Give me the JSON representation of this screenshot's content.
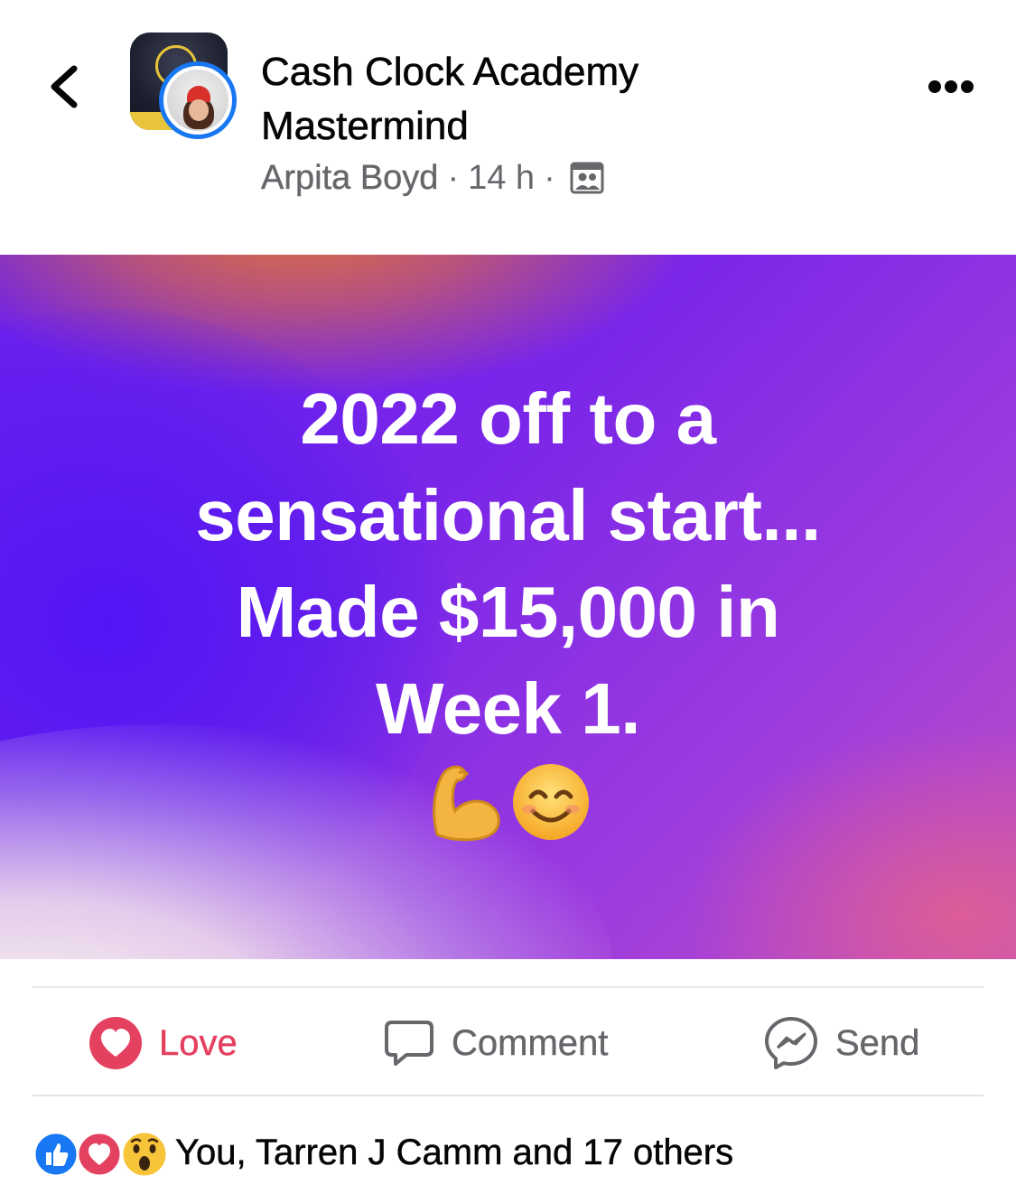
{
  "header": {
    "group_title_line1": "Cash Clock Academy",
    "group_title_line2": "Mastermind",
    "author": "Arpita Boyd",
    "separator": "·",
    "time": "14 h",
    "audience_icon": "group-members-icon"
  },
  "post": {
    "text_lines": [
      "2022 off to a",
      "sensational start...",
      "Made $15,000 in",
      "Week 1."
    ],
    "emojis": [
      "flexed-biceps",
      "smiling-face-with-smiling-eyes"
    ],
    "gradient_colors": [
      "#e8762a",
      "#5a18f0",
      "#9a3ae0",
      "#fbf3ee",
      "#e0607c"
    ]
  },
  "actions": {
    "love_label": "Love",
    "comment_label": "Comment",
    "send_label": "Send"
  },
  "reactions": {
    "icons": [
      "like",
      "love",
      "wow"
    ],
    "summary": "You, Tarren J Camm and 17 others"
  },
  "colors": {
    "love": "#e4405f",
    "like": "#1877f2",
    "secondary_text": "#65676b"
  }
}
